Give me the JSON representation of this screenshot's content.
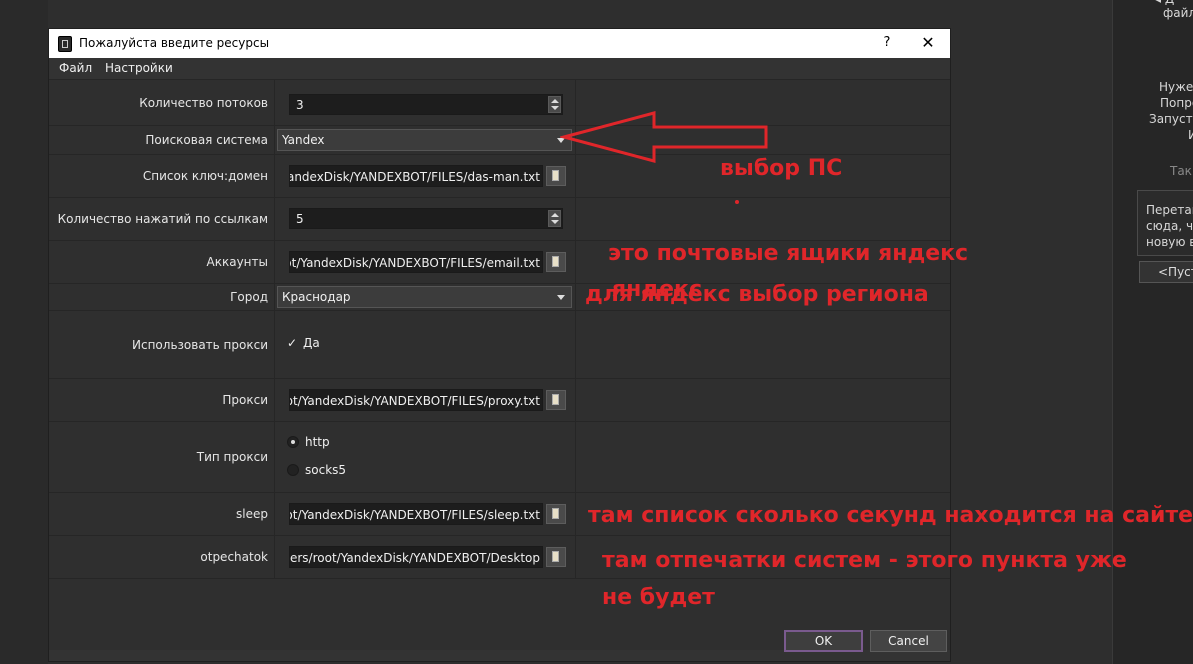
{
  "background_app": {
    "texts": [
      "файл",
      "Нужен",
      "Попро",
      "Запусти",
      "И",
      "Так"
    ],
    "drop_box_lines": [
      "Перетащ",
      "сюда, ч",
      "новую в"
    ],
    "empty_button": "<Пуст"
  },
  "dialog": {
    "title": "Пожалуйста введите ресурсы",
    "help": "?",
    "close": "✕",
    "menu": {
      "file": "Файл",
      "settings": "Настройки"
    },
    "fields": {
      "threads": {
        "label": "Количество потоков",
        "value": "3"
      },
      "search_engine": {
        "label": "Поисковая система",
        "value": "Yandex"
      },
      "keyword_list": {
        "label": "Список ключ:домен",
        "value": "YandexDisk/YANDEXBOT/FILES/das-man.txt"
      },
      "clicks": {
        "label": "Количество нажатий по ссылкам",
        "value": "5"
      },
      "accounts": {
        "label": "Аккаунты",
        "value": "oot/YandexDisk/YANDEXBOT/FILES/email.txt"
      },
      "city": {
        "label": "Город",
        "value": "Краснодар"
      },
      "use_proxy": {
        "label": "Использовать прокси",
        "check": "✓",
        "option": "Да",
        "checked": true
      },
      "proxy": {
        "label": "Прокси",
        "value": "oot/YandexDisk/YANDEXBOT/FILES/proxy.txt"
      },
      "proxy_type": {
        "label": "Тип прокси",
        "options": [
          "http",
          "socks5"
        ],
        "selected": "http"
      },
      "sleep": {
        "label": "sleep",
        "value": "oot/YandexDisk/YANDEXBOT/FILES/sleep.txt"
      },
      "otpechatok": {
        "label": "otpechatok",
        "value": "Jsers/root/YandexDisk/YANDEXBOT/Desktop"
      }
    },
    "buttons": {
      "ok": "OK",
      "cancel": "Cancel"
    }
  },
  "annotations": {
    "search_choice": "выбор ПС",
    "mailboxes": "это почтовые ящики яндекс",
    "yandex_overlap": "яндекс",
    "region": "для яндекс выбор региона",
    "sleep_note": "там список сколько секунд находится на сайте",
    "fingerprint_line1": "там отпечатки систем - этого пункта уже",
    "fingerprint_line2": "не будет",
    "color": "#e0262a"
  }
}
